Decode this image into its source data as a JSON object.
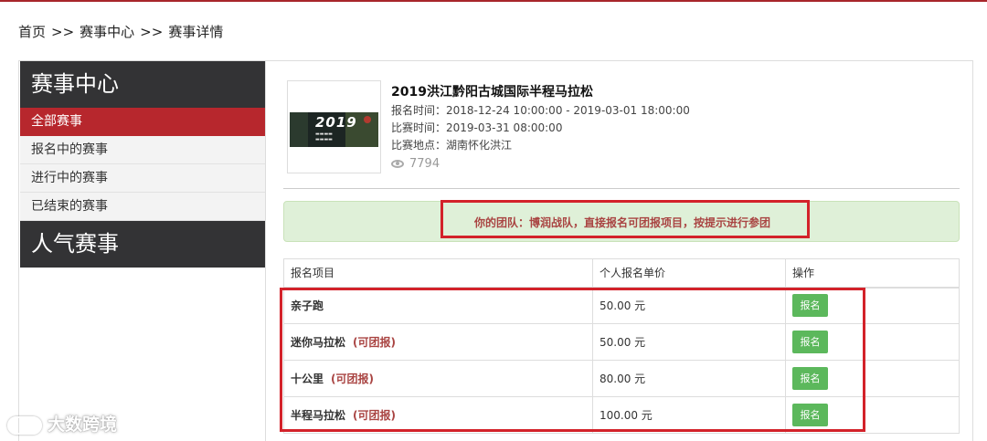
{
  "breadcrumb": {
    "home": "首页",
    "separator": ">>",
    "center": "赛事中心",
    "detail": "赛事详情"
  },
  "sidebar": {
    "heading": "赛事中心",
    "items": [
      {
        "label": "全部赛事",
        "active": true
      },
      {
        "label": "报名中的赛事",
        "active": false
      },
      {
        "label": "进行中的赛事",
        "active": false
      },
      {
        "label": "已结束的赛事",
        "active": false
      }
    ],
    "popular_heading": "人气赛事"
  },
  "event": {
    "thumbnail_text": "2019",
    "title": "2019洪江黔阳古城国际半程马拉松",
    "signup_time": "报名时间：2018-12-24 10:00:00 - 2019-03-01 18:00:00",
    "race_time": "比赛时间：2019-03-31 08:00:00",
    "location": "比赛地点：湖南怀化洪江",
    "views": "7794"
  },
  "alert": {
    "text": "你的团队：博润战队，直接报名可团报项目，按提示进行参团"
  },
  "table": {
    "headers": [
      "报名项目",
      "个人报名单价",
      "操作"
    ],
    "rows": [
      {
        "item": "亲子跑",
        "group": "",
        "price": "50.00 元",
        "action": "报名"
      },
      {
        "item": "迷你马拉松",
        "group": "(可团报)",
        "price": "50.00 元",
        "action": "报名"
      },
      {
        "item": "十公里",
        "group": "(可团报)",
        "price": "80.00 元",
        "action": "报名"
      },
      {
        "item": "半程马拉松",
        "group": "(可团报)",
        "price": "100.00 元",
        "action": "报名"
      }
    ]
  },
  "watermark": {
    "text": "大数跨境"
  },
  "colors": {
    "brand_red": "#b7272d",
    "sidebar_dark": "#333335",
    "button_green": "#5cb85c",
    "alert_bg": "#dff0d8",
    "alert_text": "#a94442",
    "annotation_red": "#d3222a"
  }
}
